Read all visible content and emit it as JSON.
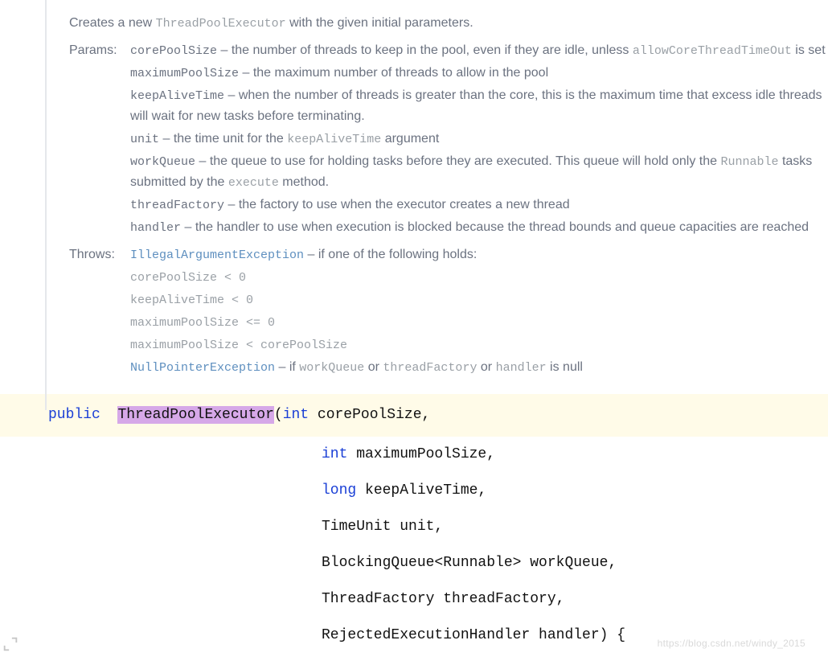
{
  "description": {
    "prefix": "Creates a new ",
    "classname": "ThreadPoolExecutor",
    "suffix": " with the given initial parameters."
  },
  "labels": {
    "params": "Params:",
    "throws": "Throws:"
  },
  "params": {
    "corePoolSize": {
      "name": "corePoolSize",
      "dash": " – ",
      "text_a": "the number of threads to keep in the pool, even if they are idle, unless ",
      "code_a": "allowCoreThreadTimeOut",
      "text_b": " is set"
    },
    "maximumPoolSize": {
      "name": "maximumPoolSize",
      "dash": " – ",
      "text": "the maximum number of threads to allow in the pool"
    },
    "keepAliveTime": {
      "name": "keepAliveTime",
      "dash": " – ",
      "text": "when the number of threads is greater than the core, this is the maximum time that excess idle threads will wait for new tasks before terminating."
    },
    "unit": {
      "name": "unit",
      "dash": " – ",
      "text_a": "the time unit for the ",
      "code_a": "keepAliveTime",
      "text_b": " argument"
    },
    "workQueue": {
      "name": "workQueue",
      "dash": " – ",
      "text_a": "the queue to use for holding tasks before they are executed. This queue will hold only the ",
      "code_a": "Runnable",
      "text_b": " tasks submitted by the ",
      "code_b": "execute",
      "text_c": " method."
    },
    "threadFactory": {
      "name": "threadFactory",
      "dash": " – ",
      "text": "the factory to use when the executor creates a new thread"
    },
    "handler": {
      "name": "handler",
      "dash": " – ",
      "text": "the handler to use when execution is blocked because the thread bounds and queue capacities are reached"
    }
  },
  "throws": {
    "iae": {
      "type": "IllegalArgumentException",
      "dash": " – ",
      "text": "if one of the following holds:"
    },
    "c1": "corePoolSize < 0",
    "c2": "keepAliveTime < 0",
    "c3": "maximumPoolSize <= 0",
    "c4": "maximumPoolSize < corePoolSize",
    "npe": {
      "type": "NullPointerException",
      "dash": " – ",
      "text_a": "if ",
      "code_a": "workQueue",
      "text_b": " or ",
      "code_b": "threadFactory",
      "text_c": " or ",
      "code_c": "handler",
      "text_d": " is null"
    }
  },
  "code": {
    "kw_public": "public",
    "cls": "ThreadPoolExecutor",
    "paren_open": "(",
    "p1_type": "int",
    "p1_name": " corePoolSize,",
    "p2_type": "int",
    "p2_name": " maximumPoolSize,",
    "p3_type": "long",
    "p3_name": " keepAliveTime,",
    "p4": "TimeUnit unit,",
    "p5": "BlockingQueue<Runnable> workQueue,",
    "p6": "ThreadFactory threadFactory,",
    "p7": "RejectedExecutionHandler handler) {"
  },
  "watermark": "https://blog.csdn.net/windy_2015"
}
